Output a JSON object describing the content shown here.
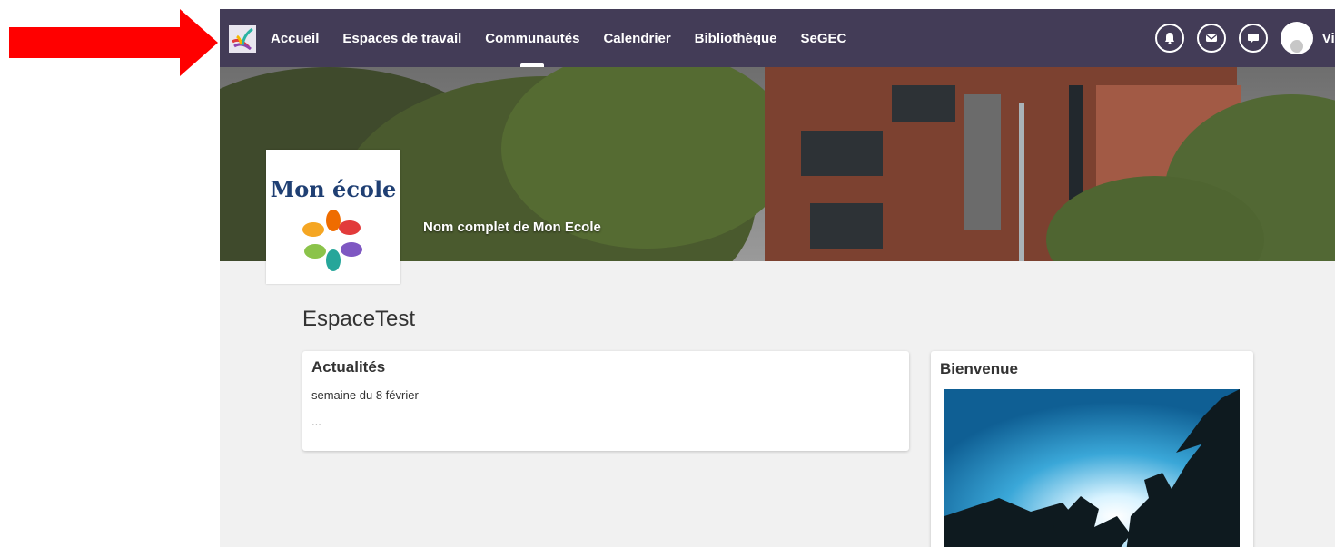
{
  "nav": {
    "items": [
      {
        "label": "Accueil"
      },
      {
        "label": "Espaces de travail"
      },
      {
        "label": "Communautés"
      },
      {
        "label": "Calendrier"
      },
      {
        "label": "Bibliothèque"
      },
      {
        "label": "SeGEC"
      }
    ],
    "active_item": "Communautés",
    "user_name": "Vic",
    "icons": [
      "bell-icon",
      "mail-icon",
      "chat-icon"
    ]
  },
  "banner": {
    "logo_text": "Mon école",
    "school_name": "Nom complet de Mon Ecole"
  },
  "space": {
    "title": "EspaceTest"
  },
  "news": {
    "title": "Actualités",
    "line1": "semaine du 8 février",
    "line2": "..."
  },
  "welcome": {
    "title": "Bienvenue"
  },
  "colors": {
    "topbar": "#433c57",
    "arrow": "#ff0000",
    "background": "#f1f1f1"
  }
}
